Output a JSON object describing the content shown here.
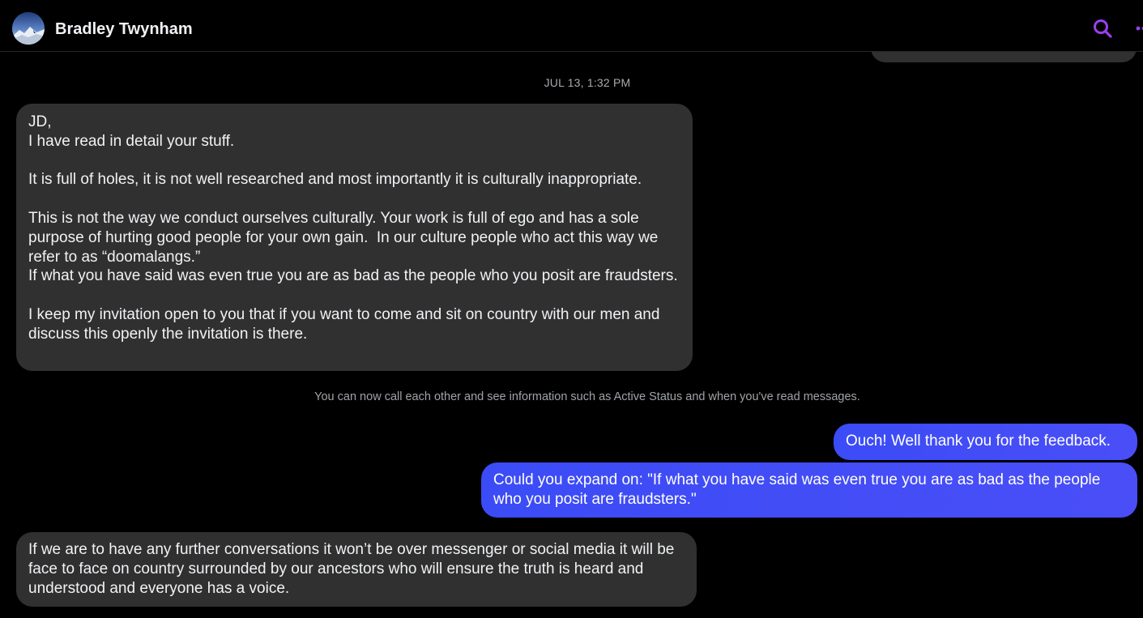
{
  "header": {
    "contact_name": "Bradley Twynham",
    "avatar_icon": "profile-photo",
    "search_icon": "search-icon",
    "more_icon": "more-options-icon",
    "accent_color": "#9b3ff0"
  },
  "conversation": {
    "timestamp": "JUL 13, 1:32 PM",
    "notice": "You can now call each other and see information such as Active Status and when you've read messages.",
    "messages": [
      {
        "direction": "incoming",
        "text": "JD,\nI have read in detail your stuff.\n\nIt is full of holes, it is not well researched and most importantly it is culturally inappropriate.\n\nThis is not the way we conduct ourselves culturally. Your work is full of ego and has a sole purpose of hurting good people for your own gain.  In our culture people who act this way we refer to as “doomalangs.”\nIf what you have said was even true you are as bad as the people who you posit are fraudsters.\n\nI keep my invitation open to you that if you want to come and sit on country with our men and discuss this openly the invitation is there."
      },
      {
        "direction": "outgoing",
        "text": "Ouch! Well thank you for the feedback."
      },
      {
        "direction": "outgoing",
        "text": "Could you expand on: \"If what you have said was even true you are as bad as the people who you posit are fraudsters.\""
      },
      {
        "direction": "incoming",
        "text": "If we are to have any further conversations it won’t be over messenger or social media it will be face to face on country surrounded by our ancestors who will ensure the truth is heard and understood and everyone has a voice."
      }
    ]
  },
  "colors": {
    "background": "#000000",
    "incoming_bubble": "#303030",
    "outgoing_bubble": "#4550f5"
  }
}
